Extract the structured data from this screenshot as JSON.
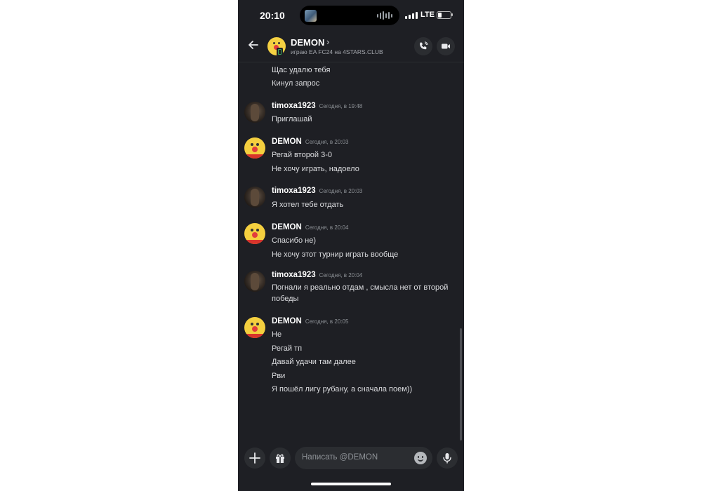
{
  "status_bar": {
    "time": "20:10",
    "network": "LTE",
    "battery_percent": 30
  },
  "header": {
    "name": "DEMON",
    "chevron": "›",
    "subtitle": "играю EA FC24 на 4STARS.CLUB",
    "icons": [
      "back-arrow-icon",
      "phone-call-icon",
      "video-camera-icon"
    ]
  },
  "messages": [
    {
      "author": "",
      "timestamp": "",
      "lines": [
        "Щас удалю тебя",
        "Кинул запрос"
      ]
    },
    {
      "author": "timoxa1923",
      "timestamp": "Сегодня, в 19:48",
      "lines": [
        "Приглашай"
      ]
    },
    {
      "author": "DEMON",
      "timestamp": "Сегодня, в 20:03",
      "lines": [
        "Регай второй 3-0",
        "Не хочу играть, надоело"
      ]
    },
    {
      "author": "timoxa1923",
      "timestamp": "Сегодня, в 20:03",
      "lines": [
        "Я хотел тебе отдать"
      ]
    },
    {
      "author": "DEMON",
      "timestamp": "Сегодня, в 20:04",
      "lines": [
        "Спасибо не)",
        "Не хочу этот турнир играть вообще"
      ]
    },
    {
      "author": "timoxa1923",
      "timestamp": "Сегодня, в 20:04",
      "lines": [
        "Погнали я реально отдам , смысла нет от второй победы"
      ]
    },
    {
      "author": "DEMON",
      "timestamp": "Сегодня, в 20:05",
      "lines": [
        "Не",
        "Регай тп",
        "Давай удачи там далее",
        "Рви",
        "Я пошёл лигу рубану, а сначала поем))"
      ]
    }
  ],
  "composer": {
    "placeholder": "Написать @DEMON",
    "icons": [
      "plus-icon",
      "gift-icon",
      "emoji-icon",
      "microphone-icon"
    ]
  },
  "colors": {
    "background": "#1e1f24",
    "surface": "#2b2d31",
    "text": "#dcdde0",
    "muted": "#8e9297"
  }
}
